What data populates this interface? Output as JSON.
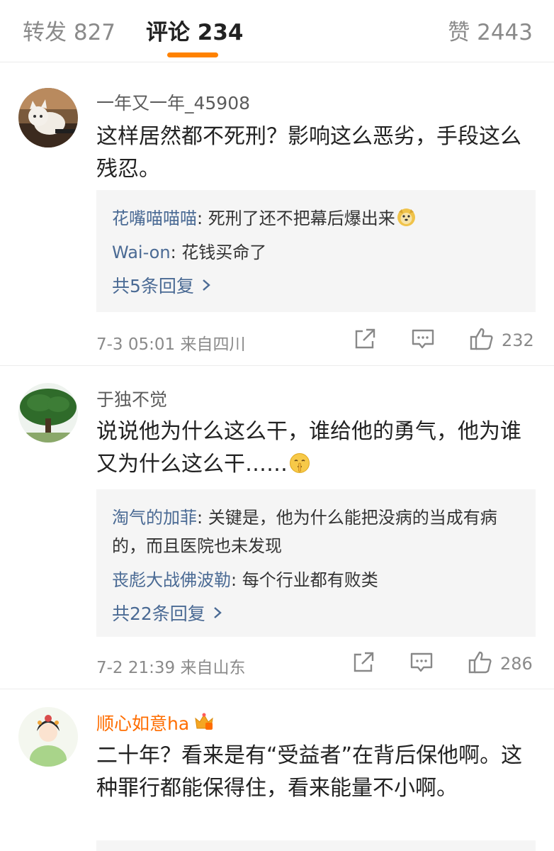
{
  "tabs": {
    "repost": "转发 827",
    "comments": "评论 234",
    "likes": "赞 2443"
  },
  "colors": {
    "accent": "#ff8200",
    "link": "#4a6a94",
    "vip_name": "#ff6d00"
  },
  "comments": [
    {
      "avatar": "cat-avatar",
      "username": "一年又一年_45908",
      "text": "这样居然都不死刑？影响这么恶劣，手段这么残忍。",
      "replies": [
        {
          "name": "花嘴喵喵喵",
          "text": ": 死刑了还不把幕后爆出来",
          "emoji": "doge-emoji"
        },
        {
          "name": "Wai-on",
          "text": ": 花钱买命了"
        }
      ],
      "more": "共5条回复",
      "meta": "7-3 05:01  来自四川",
      "likes": "232"
    },
    {
      "avatar": "tree-avatar",
      "username": "于独不觉",
      "text": "说说他为什么这么干，谁给他的勇气，他为谁又为什么这么干……",
      "text_emoji": "shush-face-emoji",
      "replies": [
        {
          "name": "淘气的加菲",
          "text": ": 关键是，他为什么能把没病的当成有病的，而且医院也未发现"
        },
        {
          "name": "丧彪大战佛波勒",
          "text": ": 每个行业都有败类"
        }
      ],
      "more": "共22条回复",
      "meta": "7-2 21:39  来自山东",
      "likes": "286"
    },
    {
      "avatar": "princess-avatar",
      "username": "顺心如意ha",
      "badge": "crown-badge-icon",
      "text": "二十年？看来是有“受益者”在背后保他啊。这种罪行都能保得住，看来能量不小啊。"
    }
  ]
}
